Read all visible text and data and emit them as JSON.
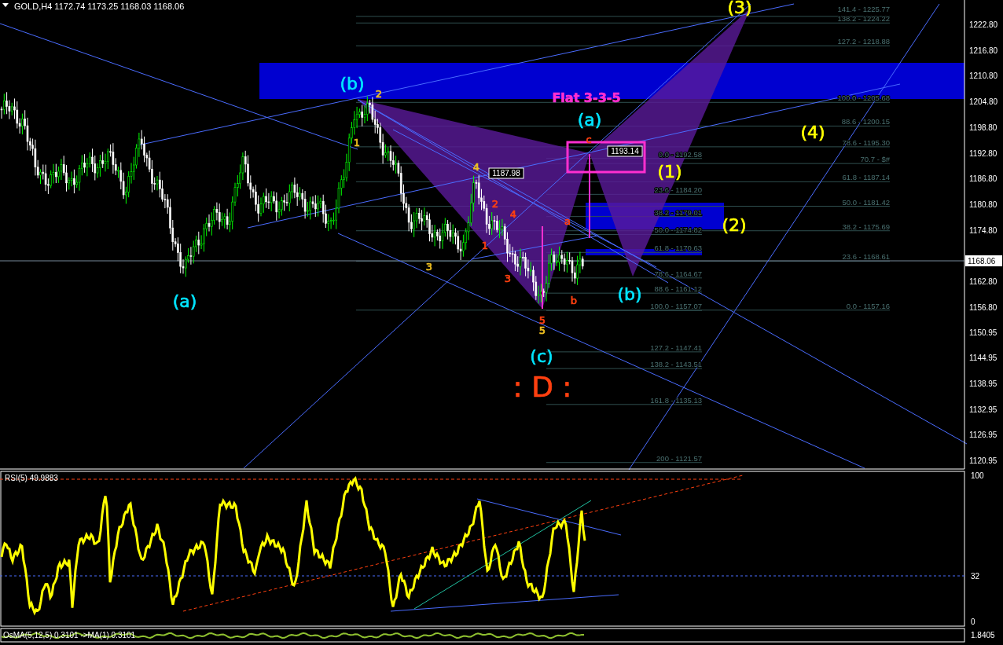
{
  "header": {
    "symbol": "GOLD,H4",
    "ohlc": "1172.74 1173.25 1168.03 1168.06"
  },
  "price_axis": {
    "ticks": [
      "1222.80",
      "1216.80",
      "1210.80",
      "1204.80",
      "1198.80",
      "1192.80",
      "1186.80",
      "1180.80",
      "1174.80",
      "1162.80",
      "1156.80",
      "1150.95",
      "1144.95",
      "1138.95",
      "1132.95",
      "1126.95",
      "1120.95"
    ],
    "current_price": "1168.06"
  },
  "fib_right": [
    "141.4 - 1225.77",
    "138.2 - 1224.22",
    "127.2 - 1218.88",
    "100.0 - 1205.68",
    "88.6 - 1200.15",
    "78.6 - 1195.30",
    "70.7 - $#",
    "61.8 - 1187.14",
    "50.0 - 1181.42",
    "38.2 - 1175.69",
    "23.6  - 1168.61",
    "0.0 - 1157.16"
  ],
  "fib_left": [
    "0.0 - 1192.58",
    "23.6  - 1184.20",
    "38.2 - 1179.01",
    "50.0 - 1174.82",
    "61.8 - 1170.63",
    "78.6 - 1164.67",
    "88.6 - 1161.12",
    "100.0 - 1157.07",
    "127.2 - 1147.41",
    "138.2 - 1143.51",
    "161.8 - 1135.13",
    "200 - 1121.57"
  ],
  "price_tags": [
    "1187.98",
    "1193.14"
  ],
  "wave_labels": [
    {
      "text": "(3)",
      "kind": "wave",
      "color": "#ffff00"
    },
    {
      "text": "(b)",
      "kind": "wave",
      "color": "#00e5ff"
    },
    {
      "text": "2",
      "kind": "sub",
      "color": "#f0c020"
    },
    {
      "text": "Flat 3-3-5",
      "kind": "title",
      "color": "#ff2fd0"
    },
    {
      "text": "(a)",
      "kind": "wave",
      "color": "#00e5ff"
    },
    {
      "text": "(4)",
      "kind": "wave",
      "color": "#ffff00"
    },
    {
      "text": "1",
      "kind": "sub",
      "color": "#f0c020"
    },
    {
      "text": "c",
      "kind": "sub",
      "color": "#ff4010"
    },
    {
      "text": "4",
      "kind": "sub",
      "color": "#f0c020"
    },
    {
      "text": "(1)",
      "kind": "wave",
      "color": "#ffff00"
    },
    {
      "text": "2",
      "kind": "sub",
      "color": "#ff4010"
    },
    {
      "text": "4",
      "kind": "sub",
      "color": "#ff4010"
    },
    {
      "text": "a",
      "kind": "sub",
      "color": "#ff4010"
    },
    {
      "text": "(2)",
      "kind": "wave",
      "color": "#ffff00"
    },
    {
      "text": "1",
      "kind": "sub",
      "color": "#ff4010"
    },
    {
      "text": "3",
      "kind": "sub",
      "color": "#f0c020"
    },
    {
      "text": "3",
      "kind": "sub",
      "color": "#ff4010"
    },
    {
      "text": "b",
      "kind": "sub",
      "color": "#ff4010"
    },
    {
      "text": "(b)",
      "kind": "wave",
      "color": "#00e5ff"
    },
    {
      "text": "(a)",
      "kind": "wave",
      "color": "#00e5ff"
    },
    {
      "text": "5",
      "kind": "sub",
      "color": "#ff4010"
    },
    {
      "text": "5",
      "kind": "sub",
      "color": "#f0c020"
    },
    {
      "text": "(c)",
      "kind": "wave",
      "color": "#00e5ff"
    },
    {
      "text": ": D :",
      "kind": "target",
      "color": "#ff4010"
    }
  ],
  "rsi": {
    "label": "RSI(5) 49.9883",
    "ticks": [
      "100",
      "32",
      "0"
    ]
  },
  "osma": {
    "label": "OsMA(5,12,5) 0.3101 ->MA(1) 0.3101",
    "tick": "1.8405"
  }
}
